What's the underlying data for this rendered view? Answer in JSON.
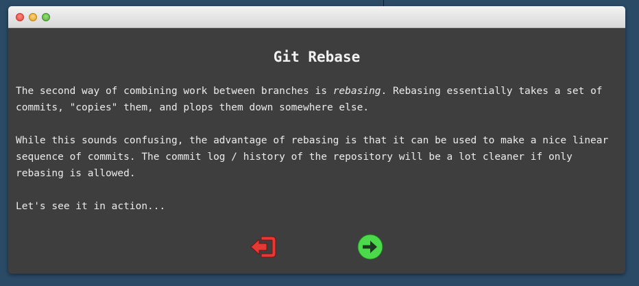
{
  "dialog": {
    "title": "Git Rebase",
    "paragraph1": {
      "before": "The second way of combining work between branches is ",
      "emphasis": "rebasing",
      "after": ". Rebasing essentially takes a set of commits, \"copies\" them, and plops them down somewhere else."
    },
    "paragraph2": "While this sounds confusing, the advantage of rebasing is that it can be used to make a nice linear sequence of commits. The commit log / history of the repository will be a lot cleaner if only rebasing is allowed.",
    "paragraph3": "Let's see it in action..."
  },
  "icons": {
    "exit": "exit-icon",
    "next": "arrow-right-circle-icon"
  },
  "colors": {
    "exit": "#e53935",
    "next": "#4cd94c",
    "window_bg": "#3e3e3e",
    "desktop_bg": "#2a4a66"
  }
}
